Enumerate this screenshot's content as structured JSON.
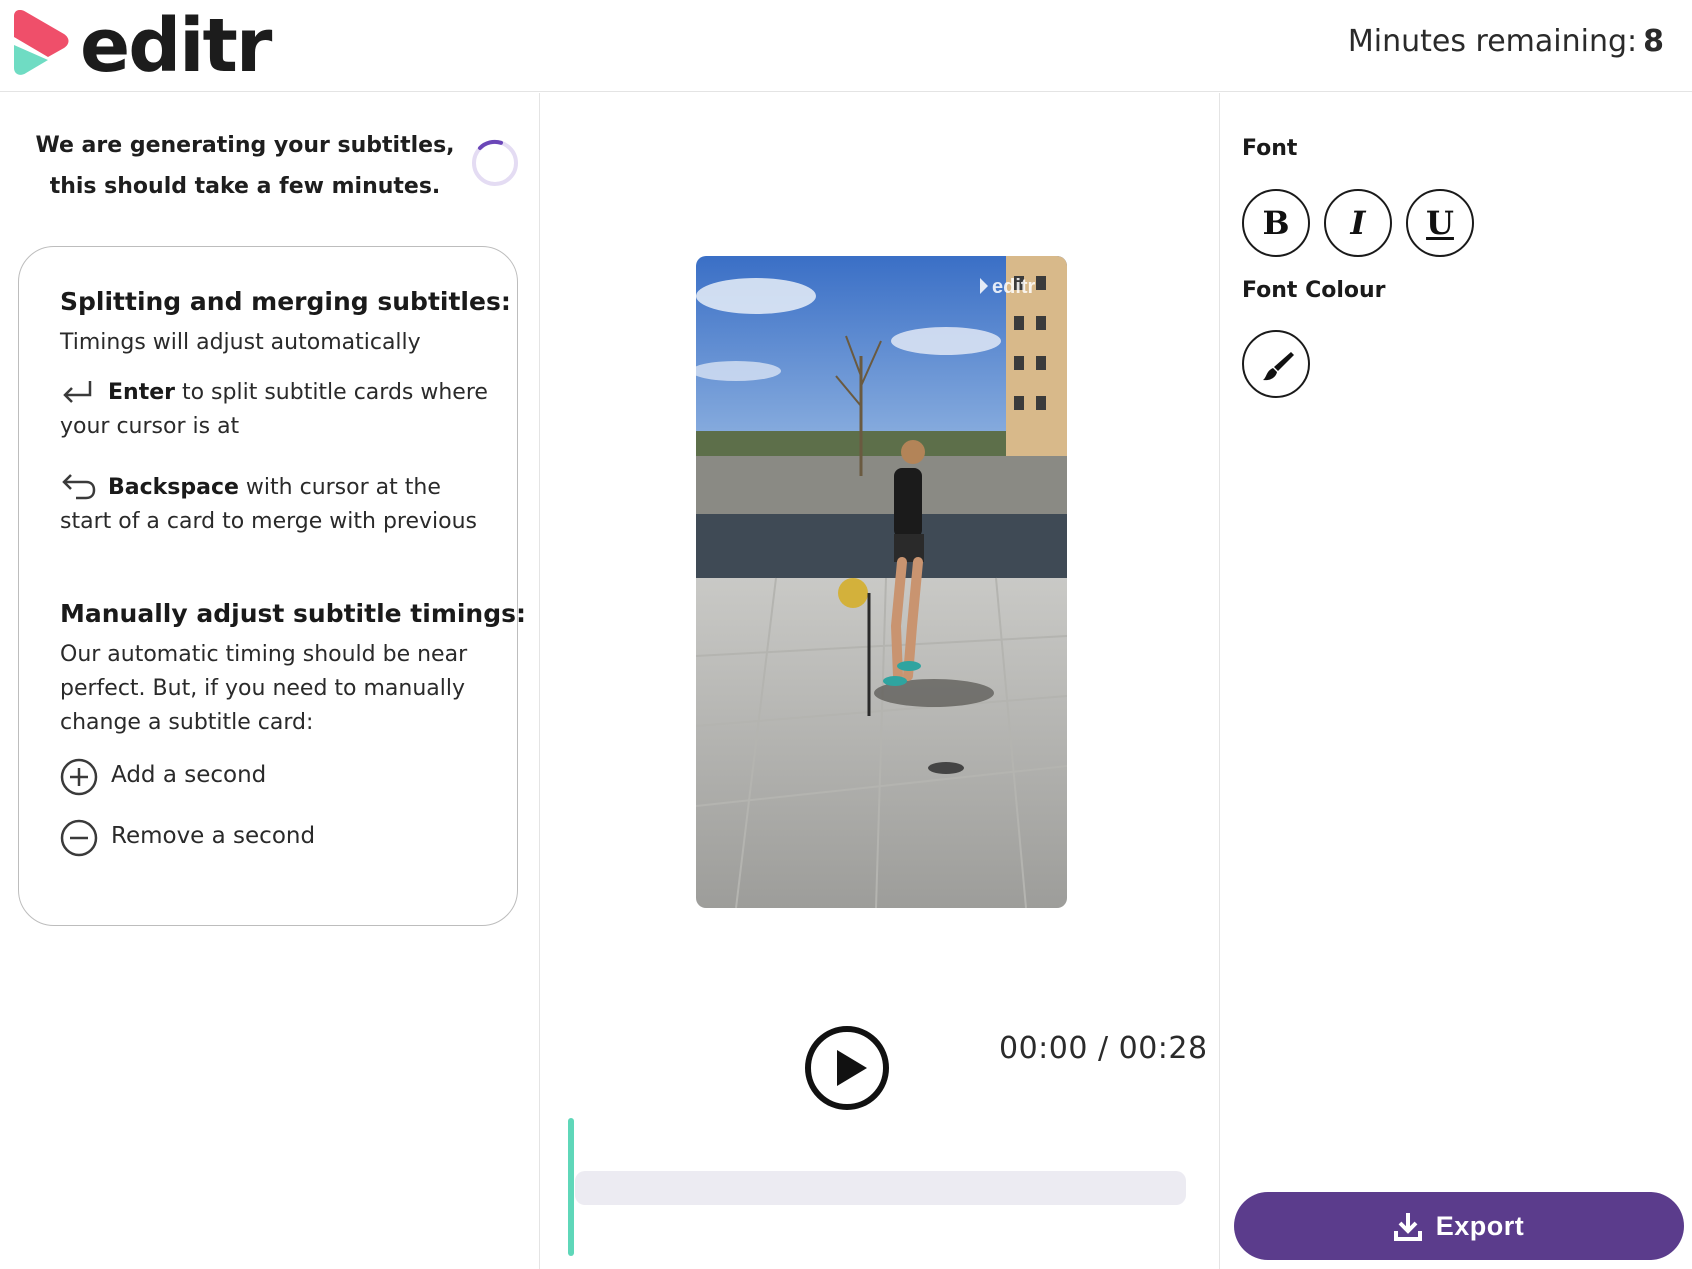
{
  "header": {
    "brand": "editr",
    "minutes_label": "Minutes remaining:",
    "minutes_value": "8"
  },
  "left": {
    "generating_text": "We are generating your subtitles, this should take a few minutes.",
    "help": {
      "split_title": "Splitting and merging subtitles:",
      "split_sub": "Timings will adjust automatically",
      "enter_key": "Enter",
      "enter_text": " to split subtitle cards where your cursor is at",
      "backspace_key": "Backspace",
      "backspace_text": " with cursor at the start of a card to merge with previous",
      "manual_title": "Manually adjust subtitle timings:",
      "manual_text": "Our automatic timing should be near perfect. But, if you need to manually change a subtitle card:",
      "add_label": "Add a second",
      "remove_label": "Remove a second"
    }
  },
  "player": {
    "watermark": "editr",
    "timecode": "00:00 / 00:28",
    "progress": 0
  },
  "right": {
    "font_label": "Font",
    "bold_label": "B",
    "italic_label": "I",
    "underline_label": "U",
    "font_colour_label": "Font Colour",
    "export_label": "Export"
  },
  "colors": {
    "accent": "#5b3c8c",
    "teal": "#5fd7b9",
    "pink": "#ef4f6a",
    "track": "#ecebf2"
  },
  "icons": [
    "editr-logo",
    "spinner-icon",
    "enter-key-icon",
    "backspace-icon",
    "plus-circle-icon",
    "minus-circle-icon",
    "play-icon",
    "brush-icon",
    "download-icon"
  ]
}
